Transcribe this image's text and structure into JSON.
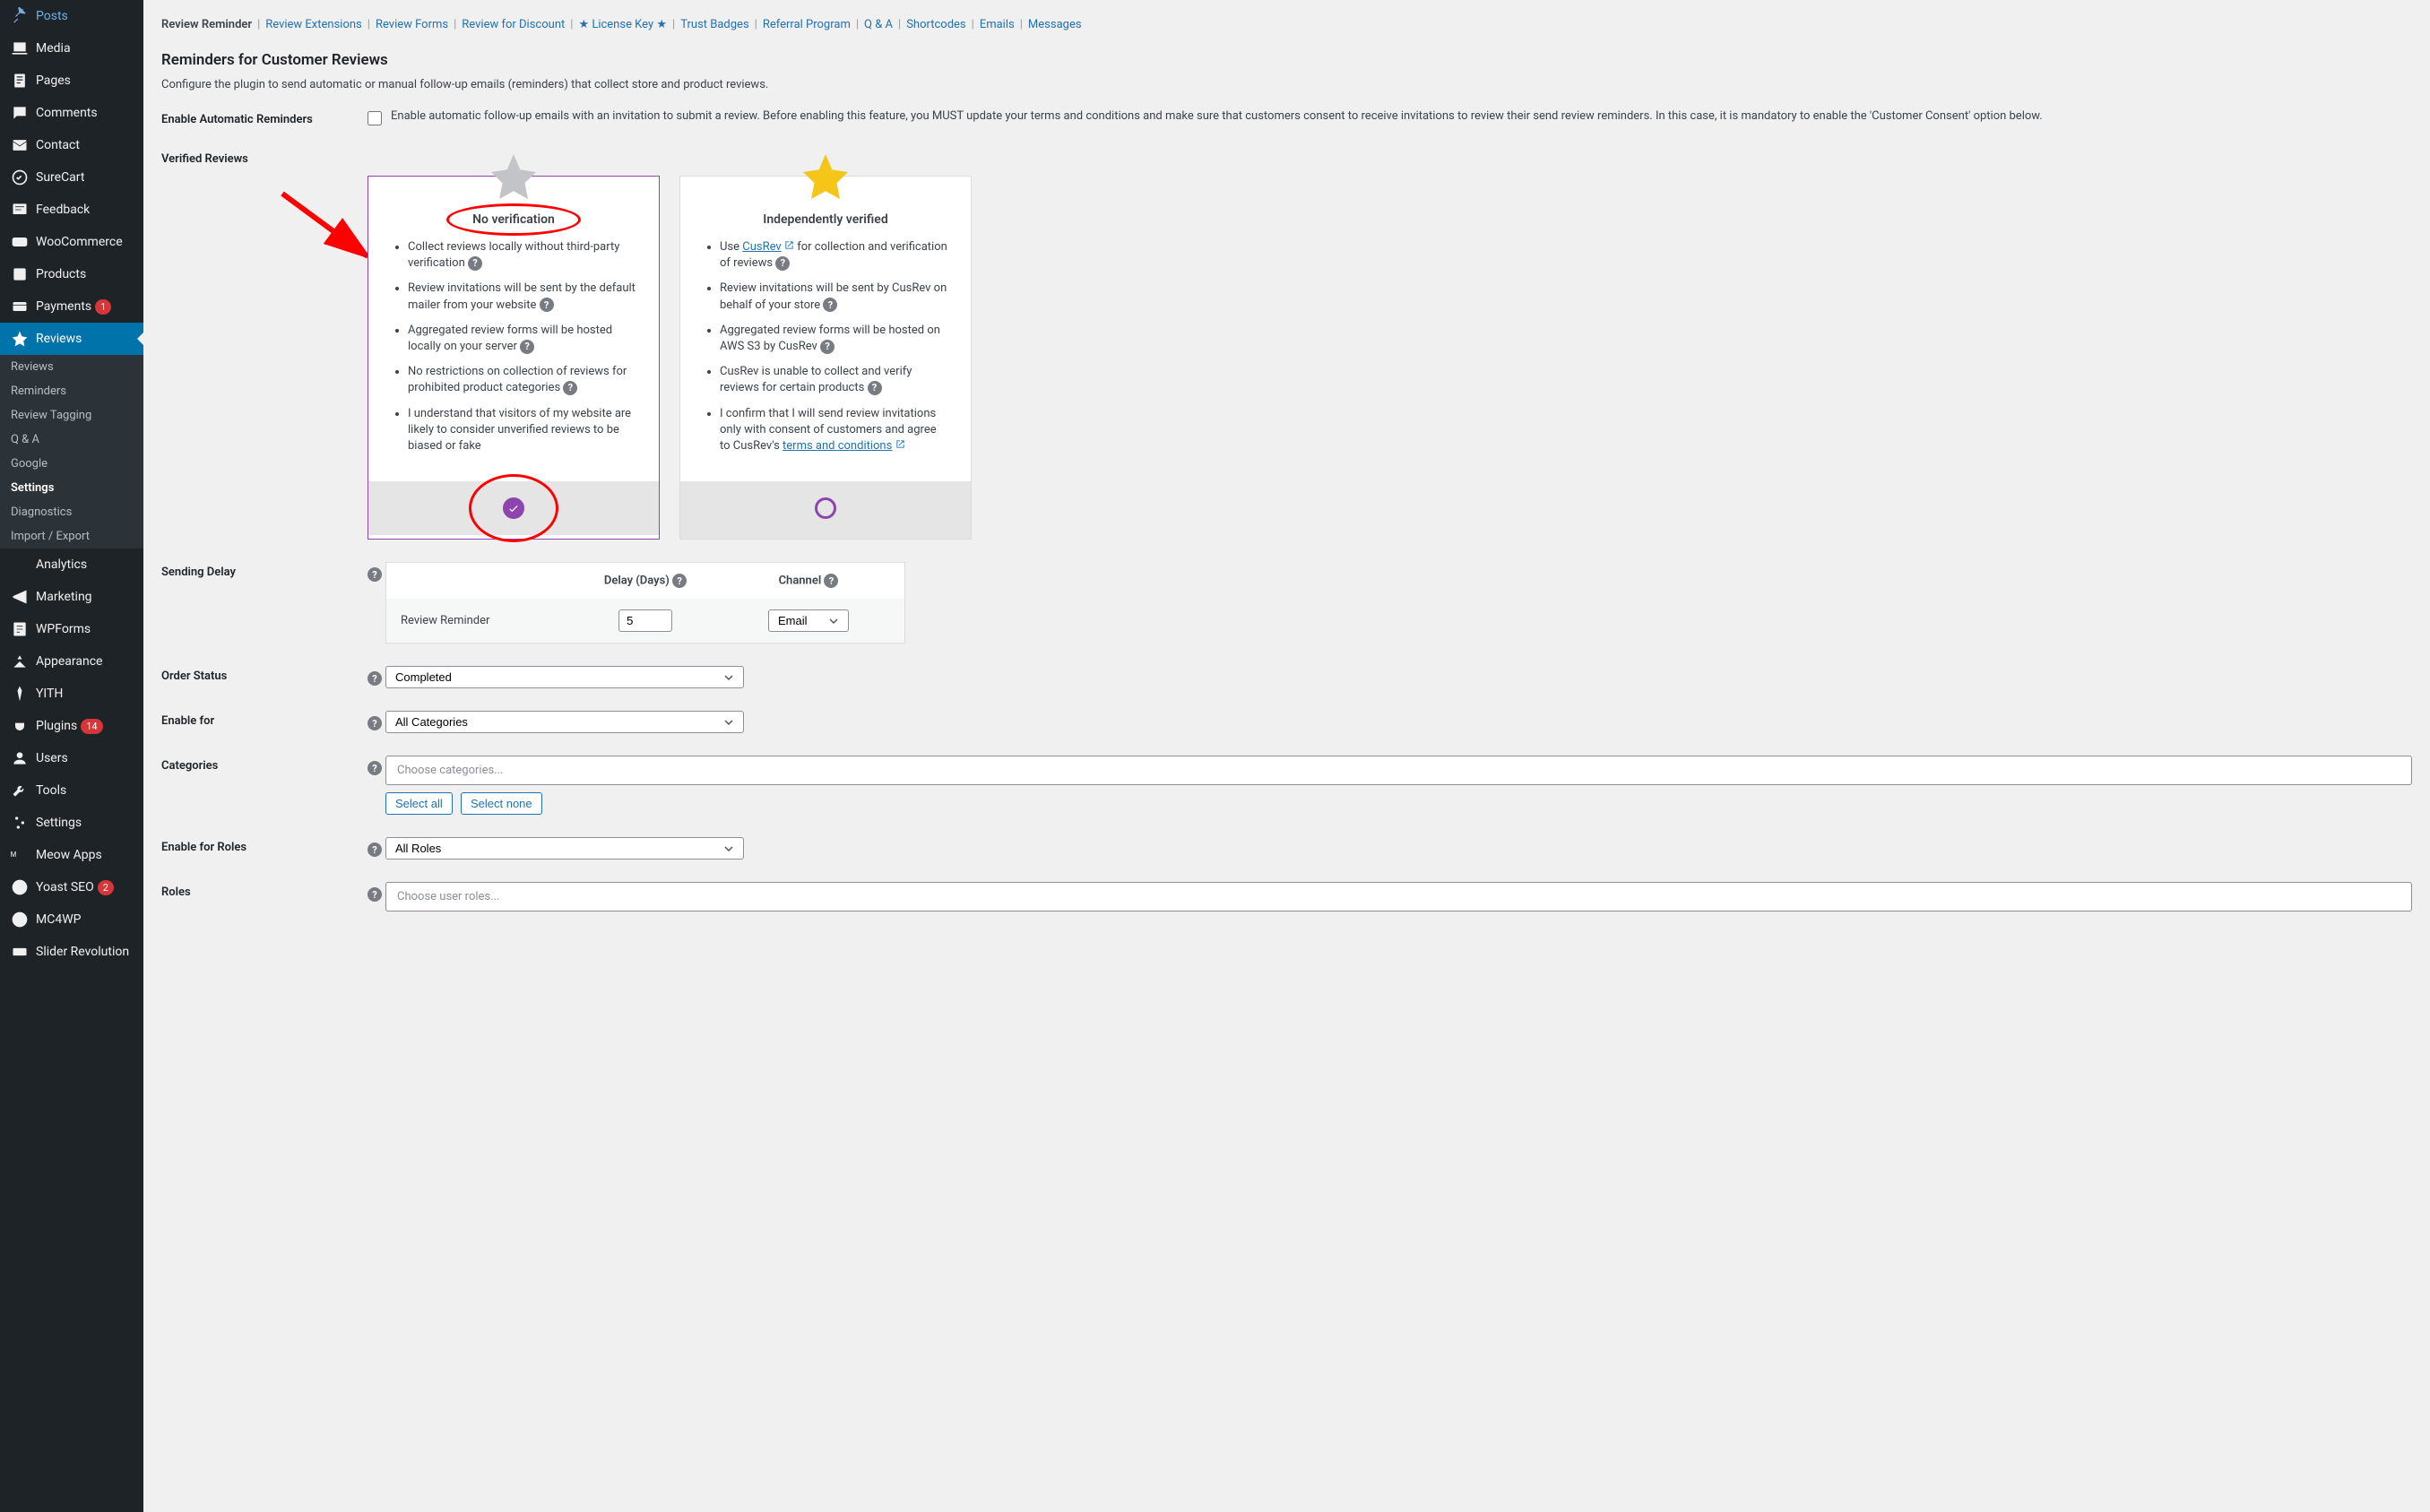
{
  "sidebar": {
    "items": [
      {
        "icon": "pin",
        "label": "Posts"
      },
      {
        "icon": "media",
        "label": "Media"
      },
      {
        "icon": "page",
        "label": "Pages"
      },
      {
        "icon": "comment",
        "label": "Comments"
      },
      {
        "icon": "mail",
        "label": "Contact"
      },
      {
        "icon": "cart",
        "label": "SureCart"
      },
      {
        "icon": "feedback",
        "label": "Feedback"
      },
      {
        "icon": "woo",
        "label": "WooCommerce"
      },
      {
        "icon": "products",
        "label": "Products"
      },
      {
        "icon": "payments",
        "label": "Payments",
        "badge": "1"
      },
      {
        "icon": "star",
        "label": "Reviews",
        "active": true
      },
      {
        "icon": "analytics",
        "label": "Analytics"
      },
      {
        "icon": "marketing",
        "label": "Marketing"
      },
      {
        "icon": "wpforms",
        "label": "WPForms"
      },
      {
        "icon": "appearance",
        "label": "Appearance"
      },
      {
        "icon": "yith",
        "label": "YITH"
      },
      {
        "icon": "plugins",
        "label": "Plugins",
        "badge": "14"
      },
      {
        "icon": "users",
        "label": "Users"
      },
      {
        "icon": "tools",
        "label": "Tools"
      },
      {
        "icon": "settings",
        "label": "Settings"
      },
      {
        "icon": "meow",
        "label": "Meow Apps"
      },
      {
        "icon": "yoast",
        "label": "Yoast SEO",
        "badge": "2"
      },
      {
        "icon": "mc4wp",
        "label": "MC4WP"
      },
      {
        "icon": "slider",
        "label": "Slider Revolution"
      }
    ],
    "subitems": [
      "Reviews",
      "Reminders",
      "Review Tagging",
      "Q & A",
      "Google",
      "Settings",
      "Diagnostics",
      "Import / Export"
    ],
    "subactive": "Settings"
  },
  "tabs": [
    "Review Reminder",
    "Review Extensions",
    "Review Forms",
    "Review for Discount",
    "★ License Key ★",
    "Trust Badges",
    "Referral Program",
    "Q & A",
    "Shortcodes",
    "Emails",
    "Messages"
  ],
  "tabs_active": "Review Reminder",
  "page_title": "Reminders for Customer Reviews",
  "page_desc": "Configure the plugin to send automatic or manual follow-up emails (reminders) that collect store and product reviews.",
  "rows": {
    "enable_auto": {
      "label": "Enable Automatic Reminders",
      "text": "Enable automatic follow-up emails with an invitation to submit a review. Before enabling this feature, you MUST update your terms and conditions and make sure that customers consent to receive invitations to review their send review reminders. In this case, it is mandatory to enable the 'Customer Consent' option below."
    },
    "verified": {
      "label": "Verified Reviews"
    },
    "sending_delay": {
      "label": "Sending Delay"
    },
    "order_status": {
      "label": "Order Status",
      "value": "Completed"
    },
    "enable_for": {
      "label": "Enable for",
      "value": "All Categories"
    },
    "categories": {
      "label": "Categories",
      "placeholder": "Choose categories...",
      "select_all": "Select all",
      "select_none": "Select none"
    },
    "enable_roles": {
      "label": "Enable for Roles",
      "value": "All Roles"
    },
    "roles": {
      "label": "Roles",
      "placeholder": "Choose user roles..."
    }
  },
  "cards": {
    "no_verify": {
      "title": "No verification",
      "items": [
        "Collect reviews locally without third-party verification",
        "Review invitations will be sent by the default mailer from your website",
        "Aggregated review forms will be hosted locally on your server",
        "No restrictions on collection of reviews for prohibited product categories",
        "I understand that visitors of my website are likely to consider unverified reviews to be biased or fake"
      ],
      "selected": true
    },
    "independent": {
      "title": "Independently verified",
      "link_text": "CusRev",
      "item0_pre": "Use ",
      "item0_post": " for collection and verification of reviews",
      "items_rest": [
        "Review invitations will be sent by CusRev on behalf of your store",
        "Aggregated review forms will be hosted on AWS S3 by CusRev",
        "CusRev is unable to collect and verify reviews for certain products"
      ],
      "item_last_pre": "I confirm that I will send review invitations only with consent of customers and agree to CusRev's ",
      "item_last_link": "terms and conditions",
      "selected": false
    }
  },
  "delay": {
    "col_delay": "Delay (Days)",
    "col_channel": "Channel",
    "row_label": "Review Reminder",
    "row_days": "5",
    "row_channel": "Email"
  }
}
